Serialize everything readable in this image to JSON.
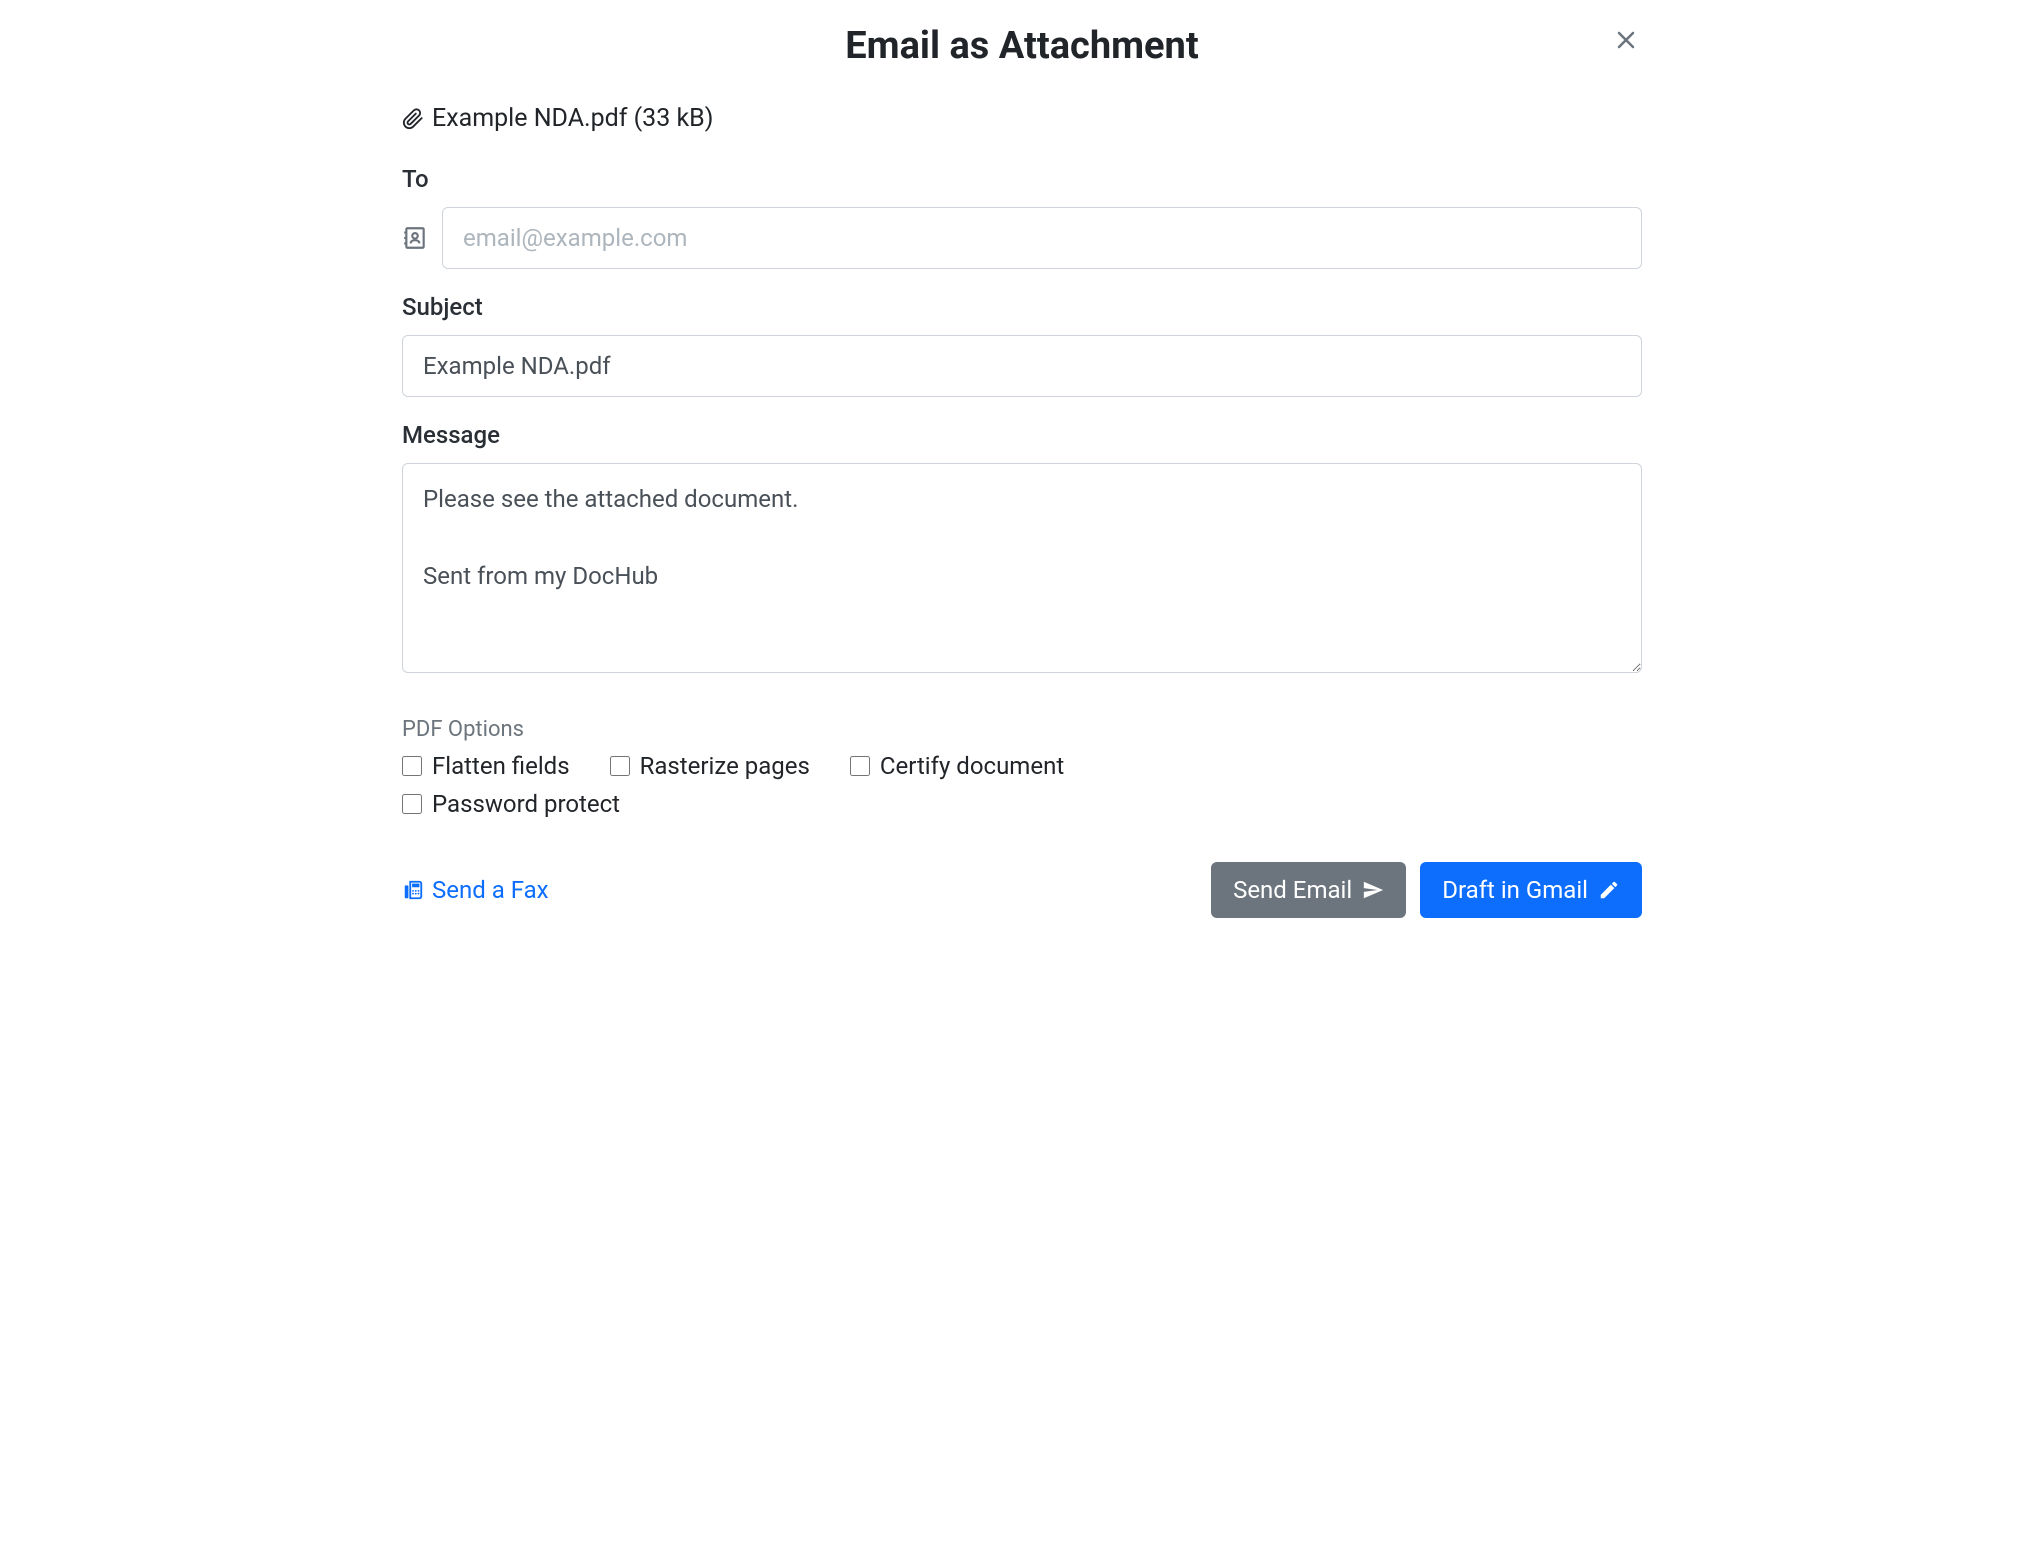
{
  "dialog": {
    "title": "Email as Attachment"
  },
  "attachment": {
    "text": "Example NDA.pdf (33 kB)"
  },
  "fields": {
    "to": {
      "label": "To",
      "placeholder": "email@example.com",
      "value": ""
    },
    "subject": {
      "label": "Subject",
      "value": "Example NDA.pdf"
    },
    "message": {
      "label": "Message",
      "value": "Please see the attached document.\n\nSent from my DocHub"
    }
  },
  "options": {
    "heading": "PDF Options",
    "flatten": "Flatten fields",
    "rasterize": "Rasterize pages",
    "certify": "Certify document",
    "password": "Password protect"
  },
  "footer": {
    "fax": "Send a Fax",
    "sendEmail": "Send Email",
    "draftGmail": "Draft in Gmail"
  }
}
